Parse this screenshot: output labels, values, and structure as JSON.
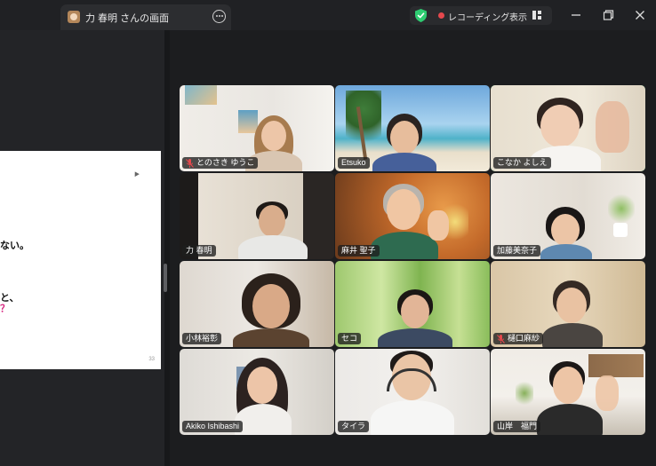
{
  "titlebar": {
    "share_tab_title": "力 春明 さんの画面",
    "recording_label": "レコーディング",
    "view_label": "表示"
  },
  "slide": {
    "line1": "ない。",
    "line2": "と、",
    "line3": "？",
    "page_number": "33"
  },
  "participants": [
    {
      "name": "とのさき ゆうこ",
      "muted": true
    },
    {
      "name": "Etsuko",
      "muted": false
    },
    {
      "name": "こなか よしえ",
      "muted": false,
      "active_speaker": true
    },
    {
      "name": "力 春明",
      "muted": false
    },
    {
      "name": "麻井 聖子",
      "muted": false
    },
    {
      "name": "加藤美奈子",
      "muted": false
    },
    {
      "name": "小林裕彰",
      "muted": false
    },
    {
      "name": "セコ",
      "muted": false
    },
    {
      "name": "樋口麻紗",
      "muted": true
    },
    {
      "name": "Akiko Ishibashi",
      "muted": false
    },
    {
      "name": "タイラ",
      "muted": false
    },
    {
      "name": "山岸　福門",
      "muted": false
    }
  ],
  "colors": {
    "active_speaker_border": "#2fd47a",
    "recording_dot": "#e5484d",
    "shield": "#2ecc71",
    "muted_icon": "#e5484d",
    "slide_accent": "#d6247e"
  }
}
